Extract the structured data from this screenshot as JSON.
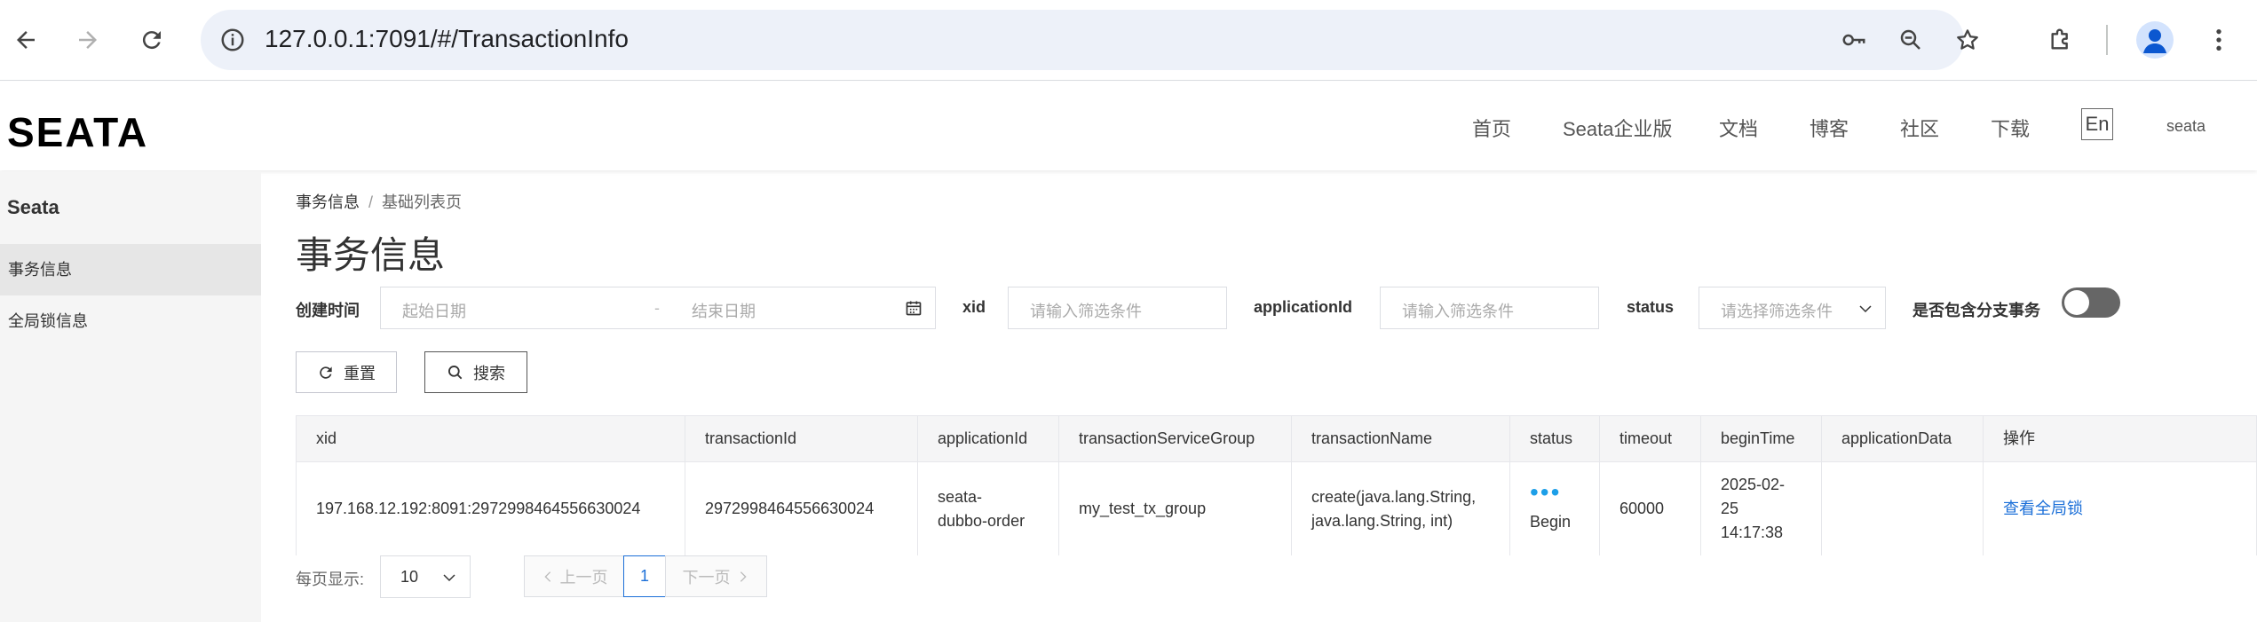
{
  "browser": {
    "url": "127.0.0.1:7091/#/TransactionInfo"
  },
  "header": {
    "logo": "SEATA",
    "nav": [
      "首页",
      "Seata企业版",
      "文档",
      "博客",
      "社区",
      "下载"
    ],
    "lang_button": "En",
    "user": "seata"
  },
  "sidebar": {
    "title": "Seata",
    "items": [
      {
        "label": "事务信息",
        "active": true
      },
      {
        "label": "全局锁信息",
        "active": false
      }
    ]
  },
  "breadcrumb": {
    "parent": "事务信息",
    "separator": "/",
    "current": "基础列表页"
  },
  "page_title": "事务信息",
  "filters": {
    "create_time_label": "创建时间",
    "start_placeholder": "起始日期",
    "range_separator": "-",
    "end_placeholder": "结束日期",
    "xid_label": "xid",
    "xid_placeholder": "请输入筛选条件",
    "app_label": "applicationId",
    "app_placeholder": "请输入筛选条件",
    "status_label": "status",
    "status_placeholder": "请选择筛选条件",
    "branch_label": "是否包含分支事务",
    "branch_on": false
  },
  "buttons": {
    "reset": "重置",
    "search": "搜索"
  },
  "table": {
    "columns": [
      "xid",
      "transactionId",
      "applicationId",
      "transactionServiceGroup",
      "transactionName",
      "status",
      "timeout",
      "beginTime",
      "applicationData",
      "操作"
    ],
    "rows": [
      {
        "xid": "197.168.12.192:8091:2972998464556630024",
        "transactionId": "2972998464556630024",
        "applicationId_line1": "seata-",
        "applicationId_line2": "dubbo-order",
        "transactionServiceGroup": "my_test_tx_group",
        "transactionName_line1": "create(java.lang.String,",
        "transactionName_line2": "java.lang.String, int)",
        "status_dots": "•••",
        "status": "Begin",
        "timeout": "60000",
        "beginTime_line1": "2025-02-",
        "beginTime_line2": "25",
        "beginTime_line3": "14:17:38",
        "applicationData": "",
        "action": "查看全局锁"
      }
    ]
  },
  "pagination": {
    "page_size_label": "每页显示:",
    "page_size": "10",
    "prev": "上一页",
    "current_page": "1",
    "next": "下一页"
  },
  "colors": {
    "accent": "#1b6fd8",
    "status_dots": "#1d9fe8",
    "sidebar_bg": "#f5f5f5"
  }
}
